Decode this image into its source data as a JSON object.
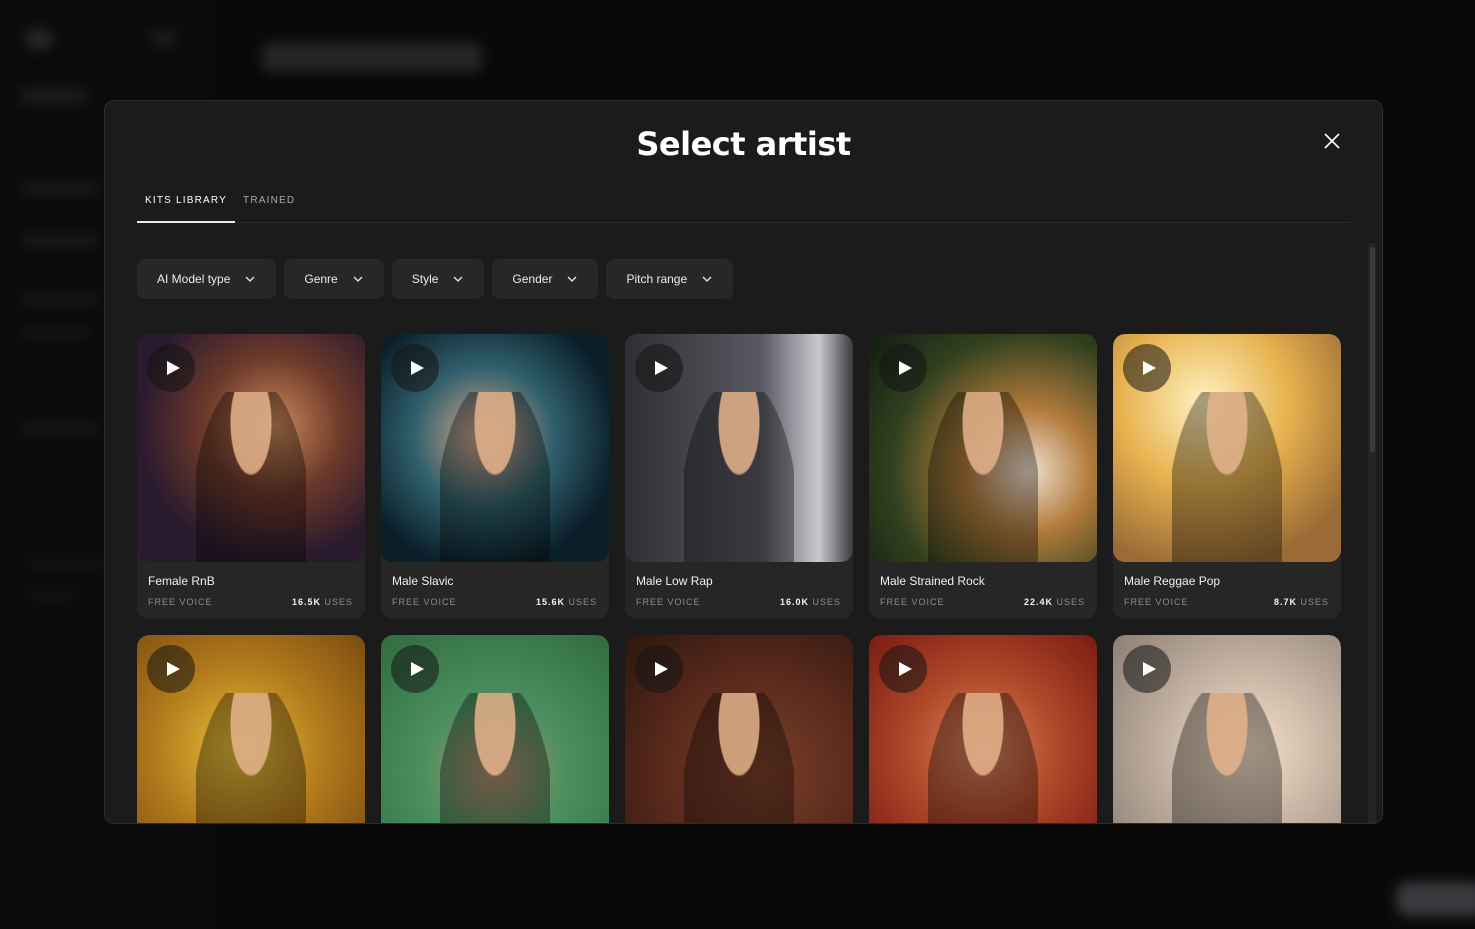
{
  "modal": {
    "title": "Select artist",
    "tabs": [
      {
        "label": "KITS LIBRARY",
        "active": true
      },
      {
        "label": "TRAINED",
        "active": false
      }
    ],
    "filters": [
      {
        "label": "AI Model type",
        "icon": "chevron-down-icon"
      },
      {
        "label": "Genre",
        "icon": "chevron-down-icon"
      },
      {
        "label": "Style",
        "icon": "chevron-down-icon"
      },
      {
        "label": "Gender",
        "icon": "chevron-down-icon"
      },
      {
        "label": "Pitch range",
        "icon": "chevron-down-icon"
      }
    ],
    "close_icon": "close-icon",
    "artists": [
      {
        "name": "Female RnB",
        "type": "FREE VOICE",
        "uses_count": "16.5K",
        "uses_label": "USES"
      },
      {
        "name": "Male Slavic",
        "type": "FREE VOICE",
        "uses_count": "15.6K",
        "uses_label": "USES"
      },
      {
        "name": "Male Low Rap",
        "type": "FREE VOICE",
        "uses_count": "16.0K",
        "uses_label": "USES"
      },
      {
        "name": "Male Strained Rock",
        "type": "FREE VOICE",
        "uses_count": "22.4K",
        "uses_label": "USES"
      },
      {
        "name": "Male Reggae Pop",
        "type": "FREE VOICE",
        "uses_count": "8.7K",
        "uses_label": "USES"
      },
      {
        "name": "",
        "type": "",
        "uses_count": "",
        "uses_label": ""
      },
      {
        "name": "",
        "type": "",
        "uses_count": "",
        "uses_label": ""
      },
      {
        "name": "",
        "type": "",
        "uses_count": "",
        "uses_label": ""
      },
      {
        "name": "",
        "type": "",
        "uses_count": "",
        "uses_label": ""
      },
      {
        "name": "",
        "type": "",
        "uses_count": "",
        "uses_label": ""
      }
    ]
  },
  "colors": {
    "modal_bg": "#1b1b1c",
    "card_bg": "#262627",
    "filter_bg": "#272728",
    "text_primary": "#ffffff",
    "text_muted": "#8d8d92"
  }
}
